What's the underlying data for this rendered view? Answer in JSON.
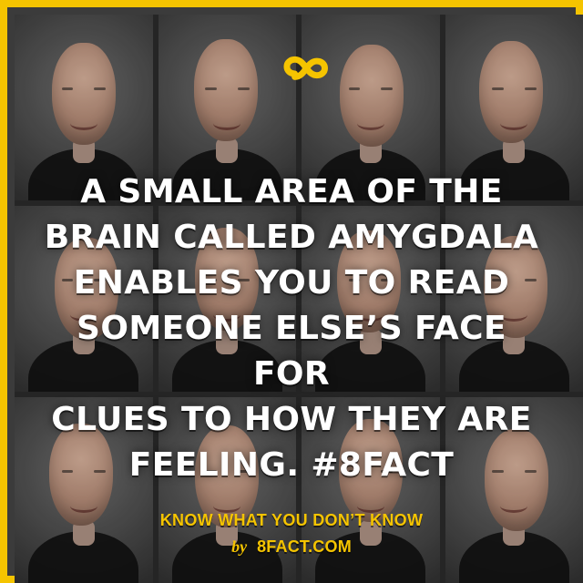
{
  "brand": {
    "accent_color": "#f5c400",
    "logo_icon": "infinity-8-icon"
  },
  "content": {
    "headline_lines": [
      "A SMALL AREA OF THE",
      "BRAIN CALLED AMYGDALA",
      "ENABLES YOU TO READ",
      "SOMEONE ELSE’S FACE FOR",
      "CLUES TO HOW THEY ARE",
      "FEELING. #8FACT"
    ],
    "tagline": "KNOW WHAT YOU DON’T KNOW",
    "byline_prefix": "by",
    "site": "8FACT.COM"
  }
}
